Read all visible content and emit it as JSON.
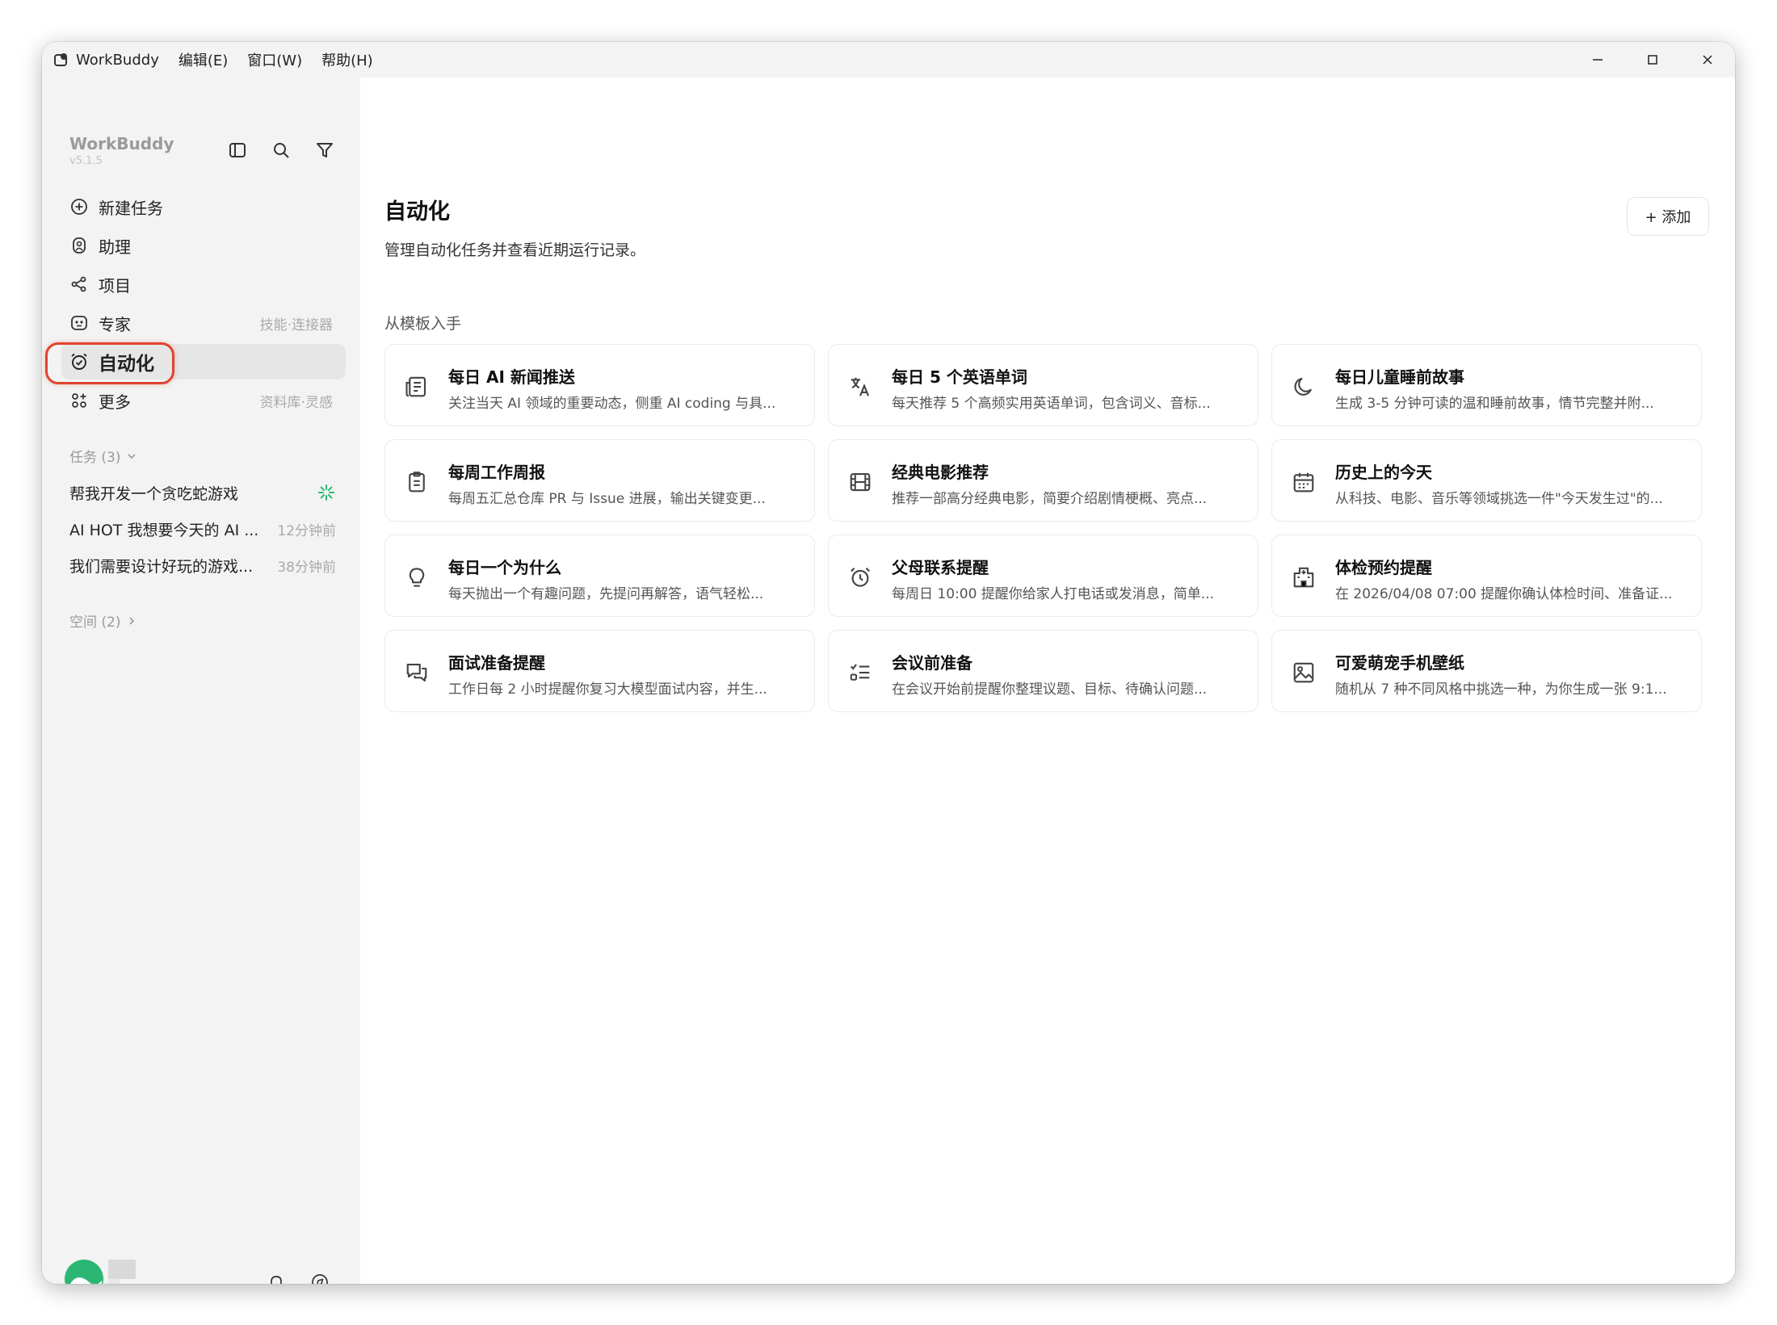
{
  "titlebar": {
    "app_name": "WorkBuddy",
    "menus": [
      "编辑(E)",
      "窗口(W)",
      "帮助(H)"
    ]
  },
  "sidebar": {
    "brand": "WorkBuddy",
    "version": "v5.1.5",
    "nav": [
      {
        "label": "新建任务",
        "hint": "",
        "icon": "plus-circle-icon"
      },
      {
        "label": "助理",
        "hint": "",
        "icon": "assistant-icon"
      },
      {
        "label": "项目",
        "hint": "",
        "icon": "project-icon"
      },
      {
        "label": "专家",
        "hint": "技能·连接器",
        "icon": "expert-icon"
      },
      {
        "label": "自动化",
        "hint": "",
        "icon": "alarm-clock-icon",
        "active": true
      },
      {
        "label": "更多",
        "hint": "资料库·灵感",
        "icon": "more-apps-icon"
      }
    ],
    "tasks_header": "任务 (3)",
    "tasks": [
      {
        "label": "帮我开发一个贪吃蛇游戏",
        "time": ""
      },
      {
        "label": "AI HOT 我想要今天的 AI ...",
        "time": "12分钟前"
      },
      {
        "label": "我们需要设计好玩的游戏...",
        "time": "38分钟前"
      }
    ],
    "spaces_header": "空间 (2)"
  },
  "main": {
    "title": "自动化",
    "subtitle": "管理自动化任务并查看近期运行记录。",
    "add_button": "+ 添加",
    "templates_header": "从模板入手",
    "templates": [
      {
        "title": "每日 AI 新闻推送",
        "desc": "关注当天 AI 领域的重要动态，侧重 AI coding 与具...",
        "icon": "newspaper-icon"
      },
      {
        "title": "每日 5 个英语单词",
        "desc": "每天推荐 5 个高频实用英语单词，包含词义、音标...",
        "icon": "translate-icon"
      },
      {
        "title": "每日儿童睡前故事",
        "desc": "生成 3-5 分钟可读的温和睡前故事，情节完整并附...",
        "icon": "moon-icon"
      },
      {
        "title": "每周工作周报",
        "desc": "每周五汇总仓库 PR 与 Issue 进展，输出关键变更...",
        "icon": "clipboard-icon"
      },
      {
        "title": "经典电影推荐",
        "desc": "推荐一部高分经典电影，简要介绍剧情梗概、亮点...",
        "icon": "film-icon"
      },
      {
        "title": "历史上的今天",
        "desc": "从科技、电影、音乐等领域挑选一件\"今天发生过\"的...",
        "icon": "calendar-icon"
      },
      {
        "title": "每日一个为什么",
        "desc": "每天抛出一个有趣问题，先提问再解答，语气轻松...",
        "icon": "lightbulb-icon"
      },
      {
        "title": "父母联系提醒",
        "desc": "每周日 10:00 提醒你给家人打电话或发消息，简单...",
        "icon": "alarm-icon"
      },
      {
        "title": "体检预约提醒",
        "desc": "在 2026/04/08 07:00 提醒你确认体检时间、准备证...",
        "icon": "hospital-icon"
      },
      {
        "title": "面试准备提醒",
        "desc": "工作日每 2 小时提醒你复习大模型面试内容，并生...",
        "icon": "chat-bubbles-icon"
      },
      {
        "title": "会议前准备",
        "desc": "在会议开始前提醒你整理议题、目标、待确认问题...",
        "icon": "checklist-icon"
      },
      {
        "title": "可爱萌宠手机壁纸",
        "desc": "随机从 7 种不同风格中挑选一种，为你生成一张 9:1...",
        "icon": "image-icon"
      }
    ]
  },
  "colors": {
    "sidebar_bg": "#f3f3f3",
    "active_item_bg": "#e6e6e6",
    "highlight_ring": "#e0442f",
    "spinner": "#2bb673",
    "avatar_green": "#2bb673"
  }
}
